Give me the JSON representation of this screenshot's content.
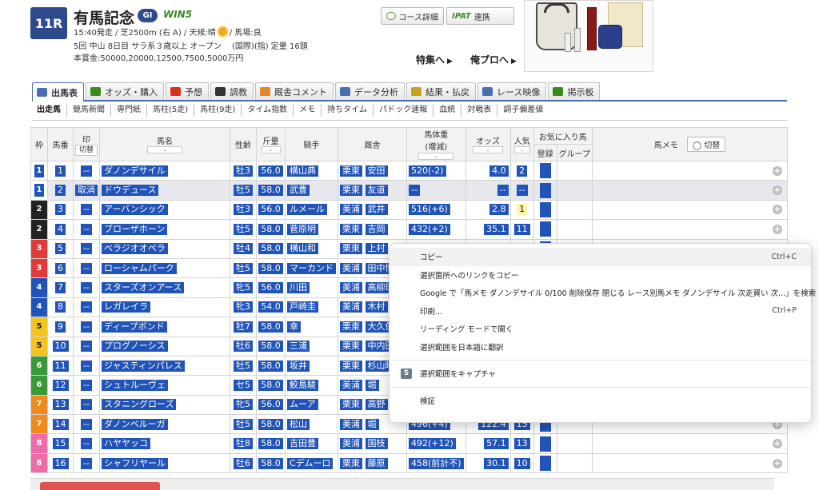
{
  "race": {
    "number": "11R",
    "name": "有馬記念",
    "grade": "GI",
    "win5": "WIN5",
    "info_line1": "15:40発走 / 芝2500m (右 A) / 天候:晴",
    "info_line1_b": "/ 馬場:良",
    "info_line2": "5回 中山 8日目 サラ系３歳以上 オープン　 (国際)(指) 定量 16頭",
    "info_line3": "本賞金:50000,20000,12500,7500,5000万円"
  },
  "header": {
    "course_button": "コース詳細",
    "ipat_logo": "IPAT",
    "ipat_button": "連携",
    "tokushu_link": "特集へ",
    "orepro_link": "俺プロへ",
    "tri": "▶"
  },
  "tabs": [
    {
      "label": "出馬表",
      "color": "#4a6fb1"
    },
    {
      "label": "オッズ・購入",
      "color": "#3a8a1f"
    },
    {
      "label": "予想",
      "color": "#d9331f"
    },
    {
      "label": "調教",
      "color": "#333333"
    },
    {
      "label": "厩舎コメント",
      "color": "#e2862a"
    },
    {
      "label": "データ分析",
      "color": "#4a6fb1"
    },
    {
      "label": "結果・払戻",
      "color": "#c8a21e"
    },
    {
      "label": "レース映像",
      "color": "#4a6fb1"
    },
    {
      "label": "掲示板",
      "color": "#3a8a1f"
    }
  ],
  "subnav": [
    "出走馬",
    "競馬新聞",
    "専門紙",
    "馬柱(5走)",
    "馬柱(9走)",
    "タイム指数",
    "メモ",
    "持ちタイム",
    "パドック速報",
    "血統",
    "対戦表",
    "調子偏差値"
  ],
  "table": {
    "headers": {
      "waku": "枠",
      "umaban": "馬番",
      "mark": "印",
      "mark_toggle": "切替",
      "name": "馬名",
      "sex_age": "性齢",
      "kinryo": "斤量",
      "jockey": "騎手",
      "stable": "厩舎",
      "weight": "馬体重",
      "weight_sub": "(増減)",
      "odds": "オッズ",
      "pop": "人気",
      "fav": "お気に入り馬",
      "fav_reg": "登録",
      "fav_group": "グループ",
      "memo": "馬メモ",
      "memo_toggle": "◯ 切替",
      "sort": "⌄"
    },
    "rows": [
      {
        "waku": "1",
        "waku_color": "#ffffff",
        "waku_text": "#2154b8",
        "umaban": "1",
        "mark": "--",
        "name": "ダノンデサイル",
        "sex_age": "牡3",
        "kinryo": "56.0",
        "jockey": "横山典",
        "loc": "栗東",
        "trainer": "安田",
        "weight": "520(-2)",
        "odds": "4.0",
        "pop": "2"
      },
      {
        "waku": "1",
        "waku_color": "#ffffff",
        "waku_text": "#2154b8",
        "umaban": "2",
        "mark": "取消",
        "name": "ドウデュース",
        "sex_age": "牡5",
        "kinryo": "58.0",
        "jockey": "武豊",
        "loc": "栗東",
        "trainer": "友道",
        "weight": "--",
        "odds": "--",
        "pop": "--",
        "scratched": true
      },
      {
        "waku": "2",
        "waku_color": "#222222",
        "waku_text": "#ffffff",
        "umaban": "3",
        "mark": "--",
        "name": "アーバンシック",
        "sex_age": "牡3",
        "kinryo": "56.0",
        "jockey": "ルメール",
        "loc": "美浦",
        "trainer": "武井",
        "weight": "516(+6)",
        "odds": "2.8",
        "pop": "1"
      },
      {
        "waku": "2",
        "waku_color": "#222222",
        "waku_text": "#ffffff",
        "umaban": "4",
        "mark": "--",
        "name": "ブローザホーン",
        "sex_age": "牡5",
        "kinryo": "58.0",
        "jockey": "菅原明",
        "loc": "栗東",
        "trainer": "吉岡",
        "weight": "432(+2)",
        "odds": "35.1",
        "pop": "11"
      },
      {
        "waku": "3",
        "waku_color": "#e03a3a",
        "waku_text": "#ffffff",
        "umaban": "5",
        "mark": "--",
        "name": "ベラジオオペラ",
        "sex_age": "牡4",
        "kinryo": "58.0",
        "jockey": "横山和",
        "loc": "栗東",
        "trainer": "上村",
        "weight": "",
        "odds": "",
        "pop": ""
      },
      {
        "waku": "3",
        "waku_color": "#e03a3a",
        "waku_text": "#ffffff",
        "umaban": "6",
        "mark": "--",
        "name": "ローシャムパーク",
        "sex_age": "牡5",
        "kinryo": "58.0",
        "jockey": "マーカンド",
        "loc": "美浦",
        "trainer": "田中博",
        "weight": "",
        "odds": "",
        "pop": ""
      },
      {
        "waku": "4",
        "waku_color": "#2154b8",
        "waku_text": "#ffffff",
        "umaban": "7",
        "mark": "--",
        "name": "スターズオンアース",
        "sex_age": "牝5",
        "kinryo": "56.0",
        "jockey": "川田",
        "loc": "美浦",
        "trainer": "高柳瑞",
        "weight": "",
        "odds": "",
        "pop": ""
      },
      {
        "waku": "4",
        "waku_color": "#2154b8",
        "waku_text": "#ffffff",
        "umaban": "8",
        "mark": "--",
        "name": "レガレイラ",
        "sex_age": "牝3",
        "kinryo": "54.0",
        "jockey": "戸崎圭",
        "loc": "美浦",
        "trainer": "木村",
        "weight": "",
        "odds": "",
        "pop": ""
      },
      {
        "waku": "5",
        "waku_color": "#f2c41d",
        "waku_text": "#222222",
        "umaban": "9",
        "mark": "--",
        "name": "ディープボンド",
        "sex_age": "牡7",
        "kinryo": "58.0",
        "jockey": "幸",
        "loc": "栗東",
        "trainer": "大久保",
        "weight": "",
        "odds": "",
        "pop": ""
      },
      {
        "waku": "5",
        "waku_color": "#f2c41d",
        "waku_text": "#222222",
        "umaban": "10",
        "mark": "--",
        "name": "プログノーシス",
        "sex_age": "牡6",
        "kinryo": "58.0",
        "jockey": "三浦",
        "loc": "栗東",
        "trainer": "中内田",
        "weight": "",
        "odds": "",
        "pop": ""
      },
      {
        "waku": "6",
        "waku_color": "#3a9a3a",
        "waku_text": "#ffffff",
        "umaban": "11",
        "mark": "--",
        "name": "ジャスティンパレス",
        "sex_age": "牡5",
        "kinryo": "58.0",
        "jockey": "坂井",
        "loc": "栗東",
        "trainer": "杉山晴",
        "weight": "",
        "odds": "",
        "pop": ""
      },
      {
        "waku": "6",
        "waku_color": "#3a9a3a",
        "waku_text": "#ffffff",
        "umaban": "12",
        "mark": "--",
        "name": "シュトルーヴェ",
        "sex_age": "セ5",
        "kinryo": "58.0",
        "jockey": "鮫島駿",
        "loc": "美浦",
        "trainer": "堀",
        "weight": "",
        "odds": "",
        "pop": ""
      },
      {
        "waku": "7",
        "waku_color": "#f08a1e",
        "waku_text": "#ffffff",
        "umaban": "13",
        "mark": "--",
        "name": "スタニングローズ",
        "sex_age": "牝5",
        "kinryo": "56.0",
        "jockey": "ムーア",
        "loc": "栗東",
        "trainer": "高野",
        "weight": "",
        "odds": "",
        "pop": ""
      },
      {
        "waku": "7",
        "waku_color": "#f08a1e",
        "waku_text": "#ffffff",
        "umaban": "14",
        "mark": "--",
        "name": "ダノンベルーガ",
        "sex_age": "牡5",
        "kinryo": "58.0",
        "jockey": "松山",
        "loc": "美浦",
        "trainer": "堀",
        "weight": "496(+4)",
        "odds": "122.4",
        "pop": "15"
      },
      {
        "waku": "8",
        "waku_color": "#ef6aa6",
        "waku_text": "#ffffff",
        "umaban": "15",
        "mark": "--",
        "name": "ハヤヤッコ",
        "sex_age": "牡8",
        "kinryo": "58.0",
        "jockey": "吉田豊",
        "loc": "美浦",
        "trainer": "国枝",
        "weight": "492(+12)",
        "odds": "57.1",
        "pop": "13"
      },
      {
        "waku": "8",
        "waku_color": "#ef6aa6",
        "waku_text": "#ffffff",
        "umaban": "16",
        "mark": "--",
        "name": "シャフリヤール",
        "sex_age": "牡6",
        "kinryo": "58.0",
        "jockey": "Cデムーロ",
        "loc": "栗東",
        "trainer": "藤原",
        "weight": "458(前計不)",
        "odds": "30.1",
        "pop": "10"
      }
    ]
  },
  "context_menu": {
    "items": [
      {
        "label": "コピー",
        "shortcut": "Ctrl+C"
      },
      {
        "label": "選択箇所へのリンクをコピー",
        "shortcut": ""
      },
      {
        "label": "Google で「馬メモ ダノンデサイル 0/100 削除保存 閉じる レース別馬メモ ダノンデサイル 次走買い 次...」を検索",
        "shortcut": ""
      },
      {
        "label": "印刷...",
        "shortcut": "Ctrl+P"
      },
      {
        "label": "リーディング モードで開く",
        "shortcut": ""
      },
      {
        "label": "選択範囲を日本語に翻訳",
        "shortcut": ""
      },
      {
        "label": "選択範囲をキャプチャ",
        "shortcut": "",
        "icon": "S"
      },
      {
        "label": "検証",
        "shortcut": ""
      }
    ]
  },
  "colors": {
    "accent": "#2d4a8c",
    "selection": "#2154b8",
    "tab_border": "#4a6fb1"
  }
}
